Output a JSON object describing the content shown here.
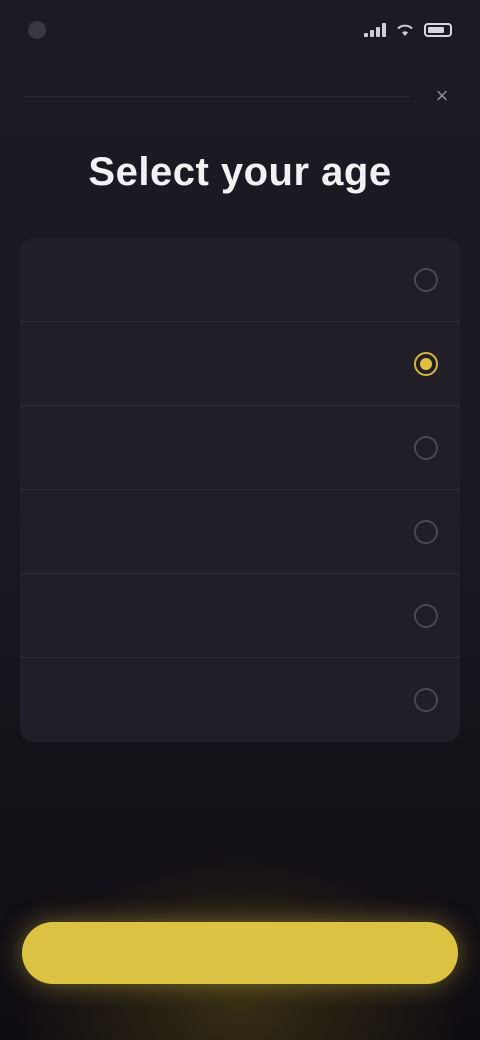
{
  "status_bar": {
    "time": "",
    "icons": [
      "signal-icon",
      "wifi-icon",
      "battery-icon"
    ]
  },
  "header": {
    "close_icon": "close-icon",
    "close_glyph": "×"
  },
  "page": {
    "title": "Select your age"
  },
  "options": {
    "items": [
      {
        "label": "",
        "selected": false
      },
      {
        "label": "",
        "selected": true
      },
      {
        "label": "",
        "selected": false
      },
      {
        "label": "",
        "selected": false
      },
      {
        "label": "",
        "selected": false
      },
      {
        "label": "",
        "selected": false
      }
    ]
  },
  "footer": {
    "continue_label": ""
  },
  "colors": {
    "background": "#1a1720",
    "accent": "#dcc243",
    "list_background": "#211e28"
  }
}
